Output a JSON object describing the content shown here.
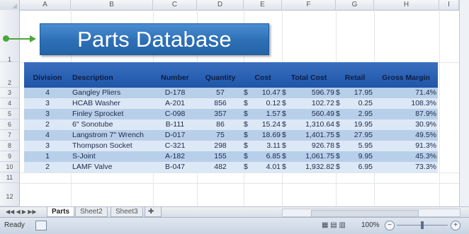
{
  "columns": [
    "A",
    "B",
    "C",
    "D",
    "E",
    "F",
    "G",
    "H",
    "I"
  ],
  "rows": [
    "1",
    "2",
    "3",
    "4",
    "5",
    "6",
    "7",
    "8",
    "9",
    "10",
    "11",
    "12"
  ],
  "title": "Parts Database",
  "table": {
    "headers": [
      "Division",
      "Description",
      "Number",
      "Quantity",
      "Cost",
      "Total Cost",
      "Retail",
      "Gross Margin"
    ],
    "rows": [
      {
        "division": "4",
        "description": "Gangley Pliers",
        "number": "D-178",
        "quantity": "57",
        "cost_sym": "$",
        "cost": "10.47",
        "total_sym": "$",
        "total": "596.79",
        "retail_sym": "$",
        "retail": "17.95",
        "margin": "71.4%"
      },
      {
        "division": "3",
        "description": "HCAB Washer",
        "number": "A-201",
        "quantity": "856",
        "cost_sym": "$",
        "cost": "0.12",
        "total_sym": "$",
        "total": "102.72",
        "retail_sym": "$",
        "retail": "0.25",
        "margin": "108.3%"
      },
      {
        "division": "3",
        "description": "Finley Sprocket",
        "number": "C-098",
        "quantity": "357",
        "cost_sym": "$",
        "cost": "1.57",
        "total_sym": "$",
        "total": "560.49",
        "retail_sym": "$",
        "retail": "2.95",
        "margin": "87.9%"
      },
      {
        "division": "2",
        "description": "6\" Sonotube",
        "number": "B-111",
        "quantity": "86",
        "cost_sym": "$",
        "cost": "15.24",
        "total_sym": "$",
        "total": "1,310.64",
        "retail_sym": "$",
        "retail": "19.95",
        "margin": "30.9%"
      },
      {
        "division": "4",
        "description": "Langstrom 7\" Wrench",
        "number": "D-017",
        "quantity": "75",
        "cost_sym": "$",
        "cost": "18.69",
        "total_sym": "$",
        "total": "1,401.75",
        "retail_sym": "$",
        "retail": "27.95",
        "margin": "49.5%"
      },
      {
        "division": "3",
        "description": "Thompson Socket",
        "number": "C-321",
        "quantity": "298",
        "cost_sym": "$",
        "cost": "3.11",
        "total_sym": "$",
        "total": "926.78",
        "retail_sym": "$",
        "retail": "5.95",
        "margin": "91.3%"
      },
      {
        "division": "1",
        "description": "S-Joint",
        "number": "A-182",
        "quantity": "155",
        "cost_sym": "$",
        "cost": "6.85",
        "total_sym": "$",
        "total": "1,061.75",
        "retail_sym": "$",
        "retail": "9.95",
        "margin": "45.3%"
      },
      {
        "division": "2",
        "description": "LAMF Valve",
        "number": "B-047",
        "quantity": "482",
        "cost_sym": "$",
        "cost": "4.01",
        "total_sym": "$",
        "total": "1,932.82",
        "retail_sym": "$",
        "retail": "6.95",
        "margin": "73.3%"
      }
    ]
  },
  "tabs": {
    "active": "Parts",
    "others": [
      "Sheet2",
      "Sheet3"
    ],
    "nav": "◀◀ ◀ ▶ ▶▶"
  },
  "status": {
    "ready": "Ready",
    "zoom": "100%",
    "zoom_minus": "−",
    "zoom_plus": "+"
  },
  "colors": {
    "banner": "#2d6fb5",
    "header_row": "#1f56a8",
    "band_light": "#dde8f6",
    "band_dark": "#b8cfe9",
    "callout": "#4aa63a"
  }
}
